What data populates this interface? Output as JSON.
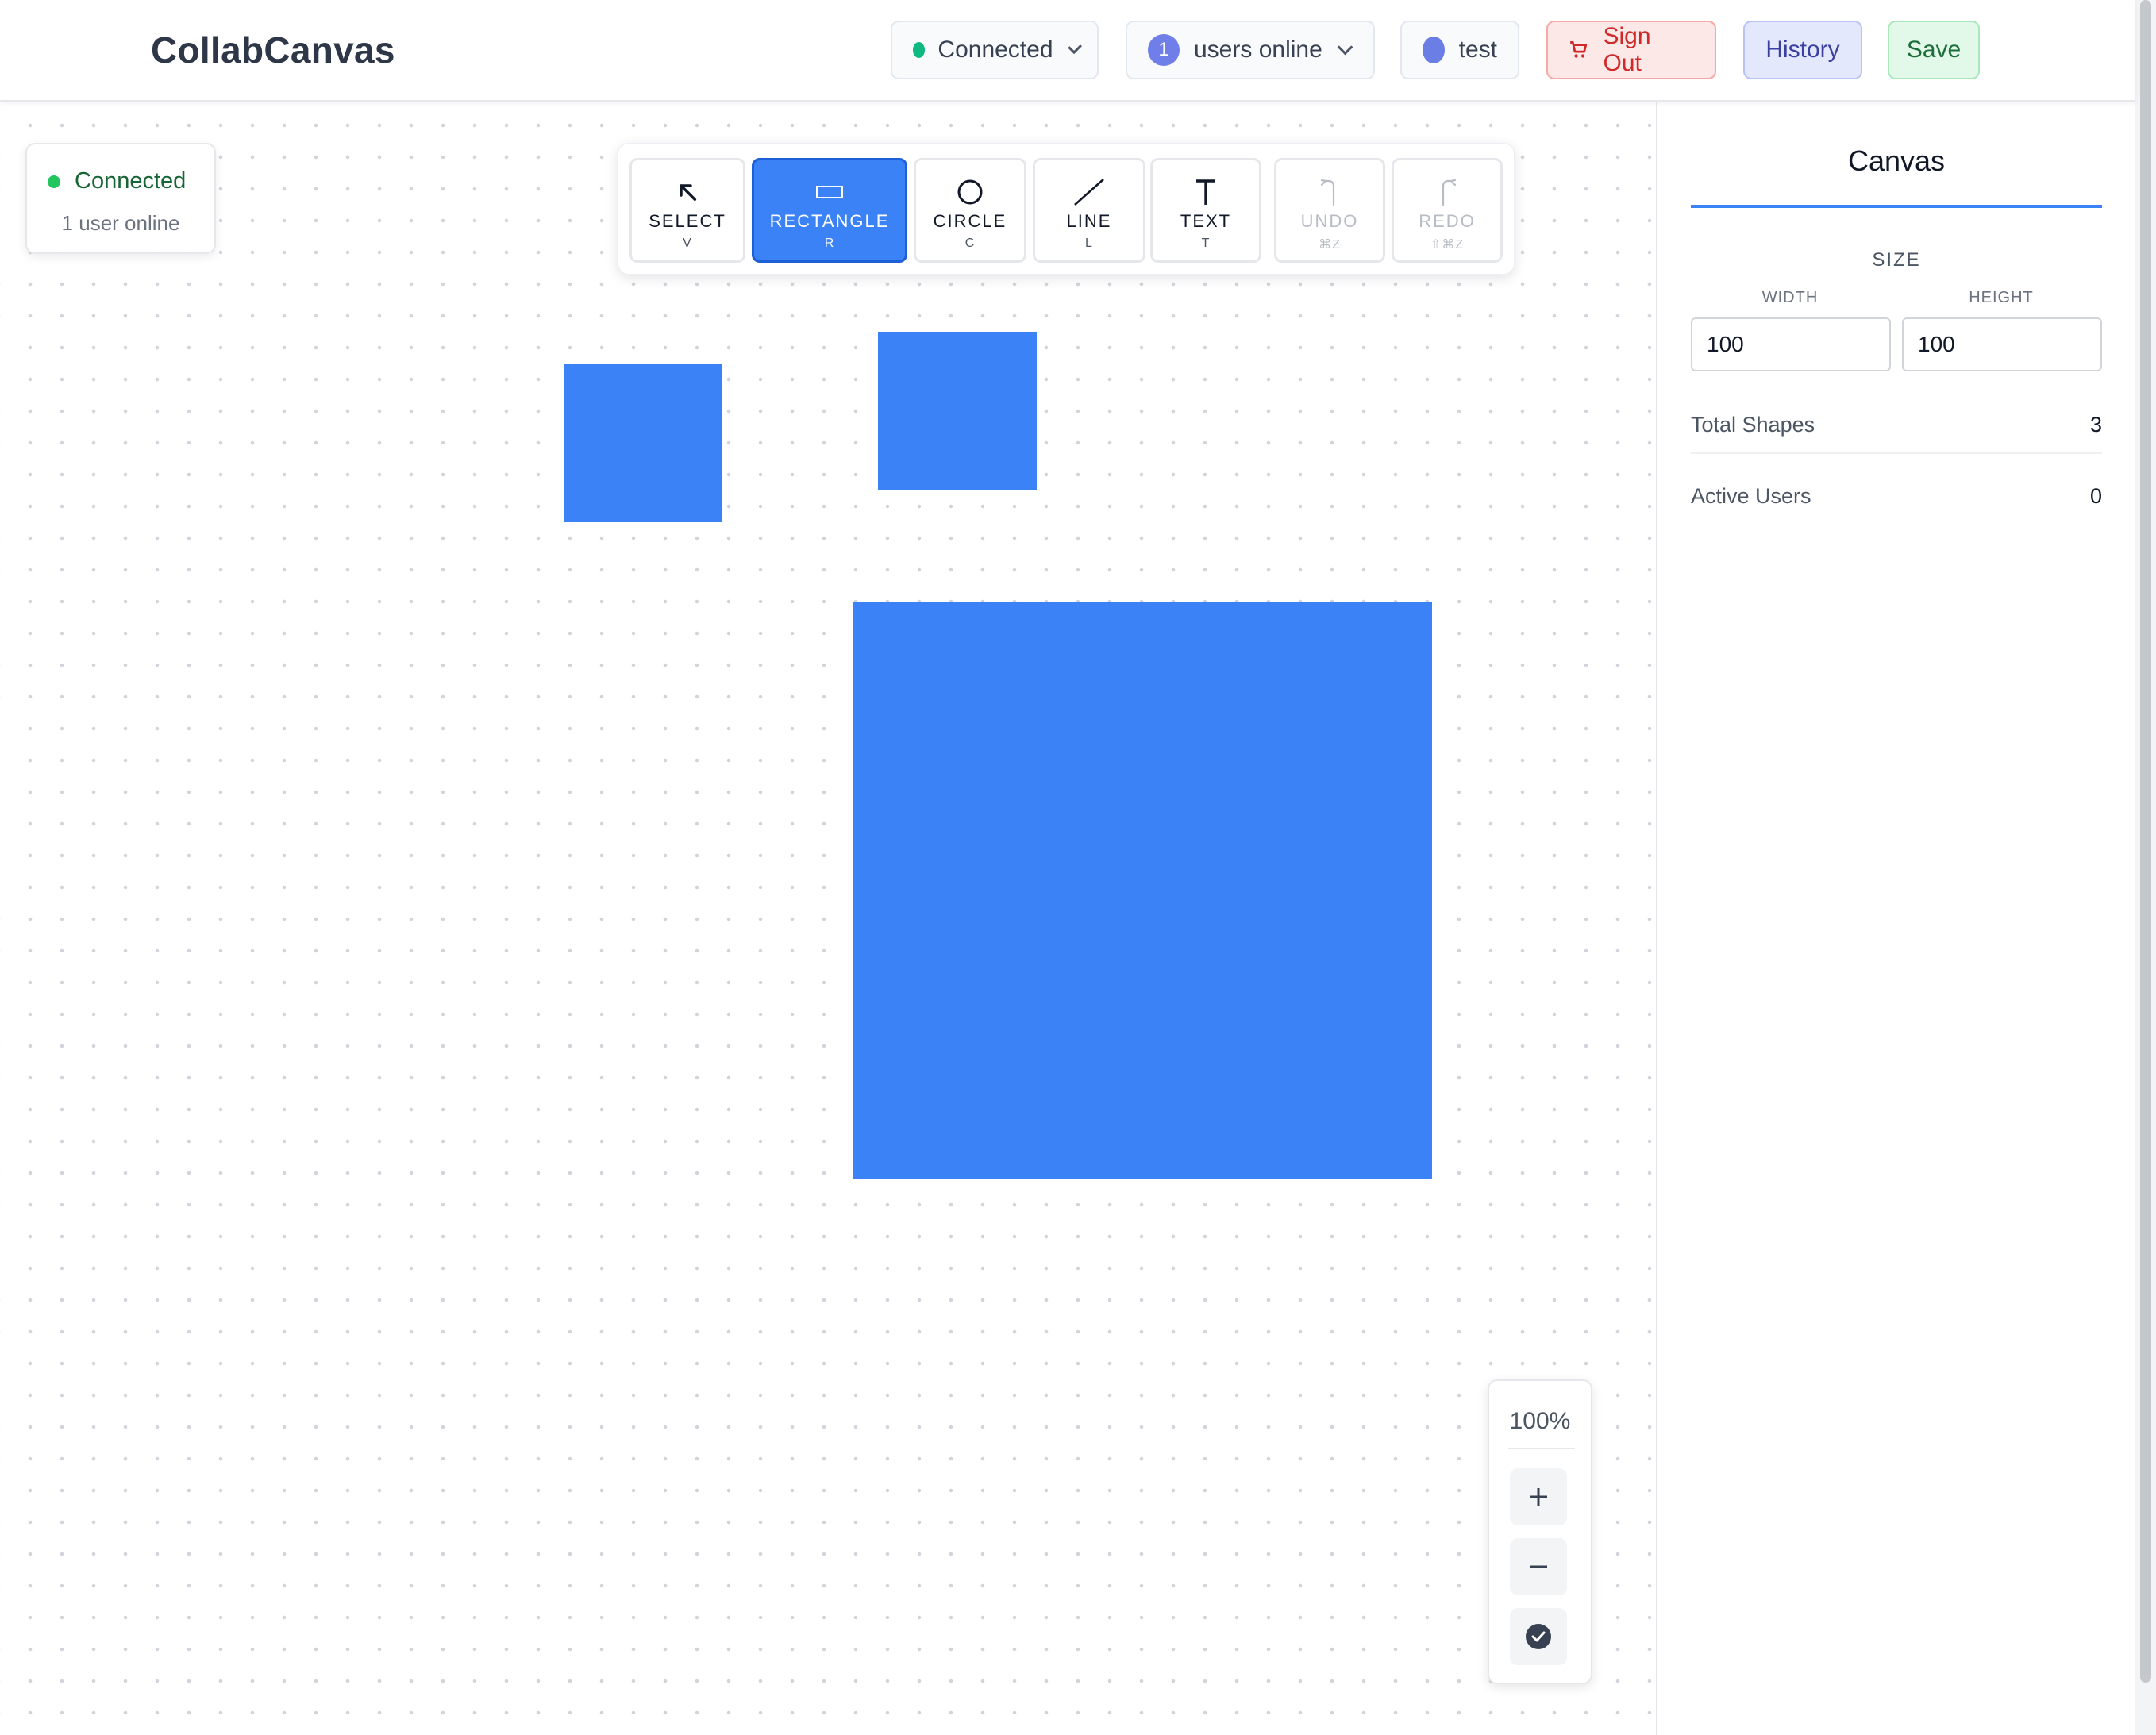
{
  "header": {
    "title": "CollabCanvas",
    "connection_label": "Connected",
    "users_count": "1",
    "users_label": "users online",
    "current_user": "test",
    "signout_label": "Sign Out",
    "history_label": "History",
    "save_label": "Save"
  },
  "presence": {
    "status": "Connected",
    "users": "1 user online"
  },
  "toolbar": {
    "tools": [
      {
        "label": "SELECT",
        "key": "V",
        "icon": "select-arrow-icon",
        "active": false,
        "disabled": false
      },
      {
        "label": "RECTANGLE",
        "key": "R",
        "icon": "rectangle-icon",
        "active": true,
        "disabled": false
      },
      {
        "label": "CIRCLE",
        "key": "C",
        "icon": "circle-icon",
        "active": false,
        "disabled": false
      },
      {
        "label": "LINE",
        "key": "L",
        "icon": "line-icon",
        "active": false,
        "disabled": false
      },
      {
        "label": "TEXT",
        "key": "T",
        "icon": "text-icon",
        "active": false,
        "disabled": false
      },
      {
        "label": "UNDO",
        "key": "⌘Z",
        "icon": "undo-icon",
        "active": false,
        "disabled": true
      },
      {
        "label": "REDO",
        "key": "⇧⌘Z",
        "icon": "redo-icon",
        "active": false,
        "disabled": true
      }
    ]
  },
  "zoom": {
    "level": "100%",
    "zoom_in_icon": "plus-icon",
    "zoom_out_icon": "minus-icon",
    "fit_icon": "check-circle-icon"
  },
  "sidebar": {
    "tab": "Canvas",
    "section": "SIZE",
    "width_label": "WIDTH",
    "height_label": "HEIGHT",
    "width_value": "100",
    "height_value": "100",
    "stats": [
      {
        "label": "Total Shapes",
        "value": "3"
      },
      {
        "label": "Active Users",
        "value": "0"
      }
    ]
  },
  "colors": {
    "accent": "#3b82f6",
    "connected": "#10b981",
    "shape_fill": "#3b82f6"
  }
}
